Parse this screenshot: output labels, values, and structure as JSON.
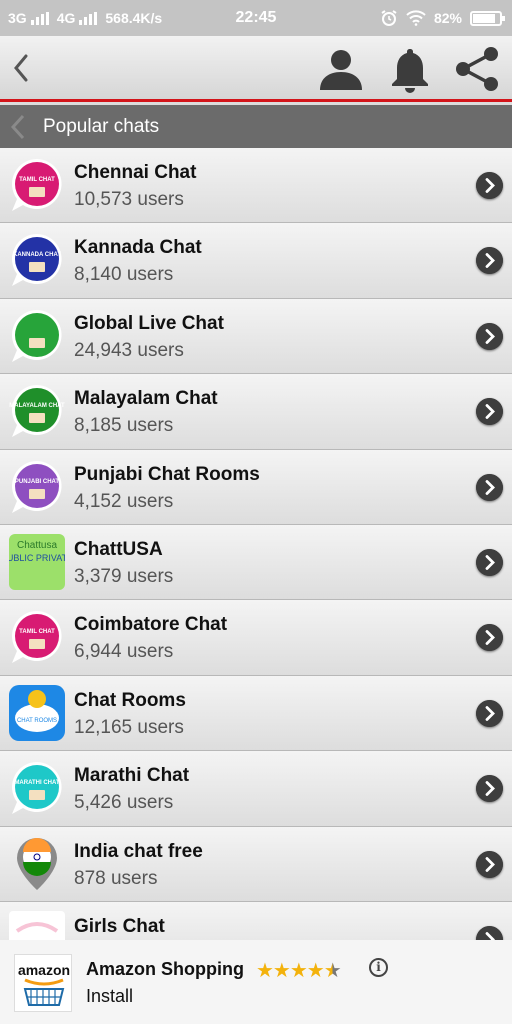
{
  "status_bar": {
    "network1": "3G",
    "network2": "4G",
    "speed": "568.4K/s",
    "time": "22:45",
    "battery": "82%"
  },
  "section": {
    "title": "Popular chats"
  },
  "chats": [
    {
      "name": "Chennai Chat",
      "users": "10,573 users",
      "logo_text": "TAMIL CHAT",
      "color": "#d81b73",
      "icon": "chat-bubble-logo"
    },
    {
      "name": "Kannada Chat",
      "users": "8,140 users",
      "logo_text": "KANNADA CHAT",
      "color": "#2332a6",
      "icon": "chat-bubble-logo"
    },
    {
      "name": "Global Live Chat",
      "users": "24,943 users",
      "logo_text": "",
      "color": "#27a43a",
      "icon": "chat-bubble-logo"
    },
    {
      "name": "Malayalam Chat",
      "users": "8,185 users",
      "logo_text": "MALAYALAM CHAT",
      "color": "#1f8f2a",
      "icon": "chat-bubble-logo"
    },
    {
      "name": "Punjabi Chat Rooms",
      "users": "4,152 users",
      "logo_text": "PUNJABI CHAT",
      "color": "#8e4fc0",
      "icon": "chat-bubble-logo"
    },
    {
      "name": "ChattUSA",
      "users": "3,379 users",
      "logo_text": "PUBLIC PRIVATE",
      "color": "#9ce06a",
      "icon": "chattusa-logo"
    },
    {
      "name": "Coimbatore Chat",
      "users": "6,944 users",
      "logo_text": "TAMIL CHAT",
      "color": "#d81b73",
      "icon": "chat-bubble-logo"
    },
    {
      "name": "Chat Rooms",
      "users": "12,165 users",
      "logo_text": "CHAT ROOMS",
      "color": "#1e88e5",
      "icon": "chat-rooms-logo"
    },
    {
      "name": "Marathi Chat",
      "users": "5,426 users",
      "logo_text": "MARATHI CHAT",
      "color": "#1ec8c8",
      "icon": "chat-bubble-logo"
    },
    {
      "name": "India chat free",
      "users": "878 users",
      "logo_text": "",
      "color": "#8a8a8a",
      "icon": "india-pin-logo"
    },
    {
      "name": "Girls Chat",
      "users": "",
      "logo_text": "",
      "color": "#f7c4d6",
      "icon": "girls-chat-logo"
    }
  ],
  "ad": {
    "title": "Amazon Shopping",
    "button": "Install",
    "logo_text": "amazon",
    "rating": 4.5,
    "info": "i"
  }
}
